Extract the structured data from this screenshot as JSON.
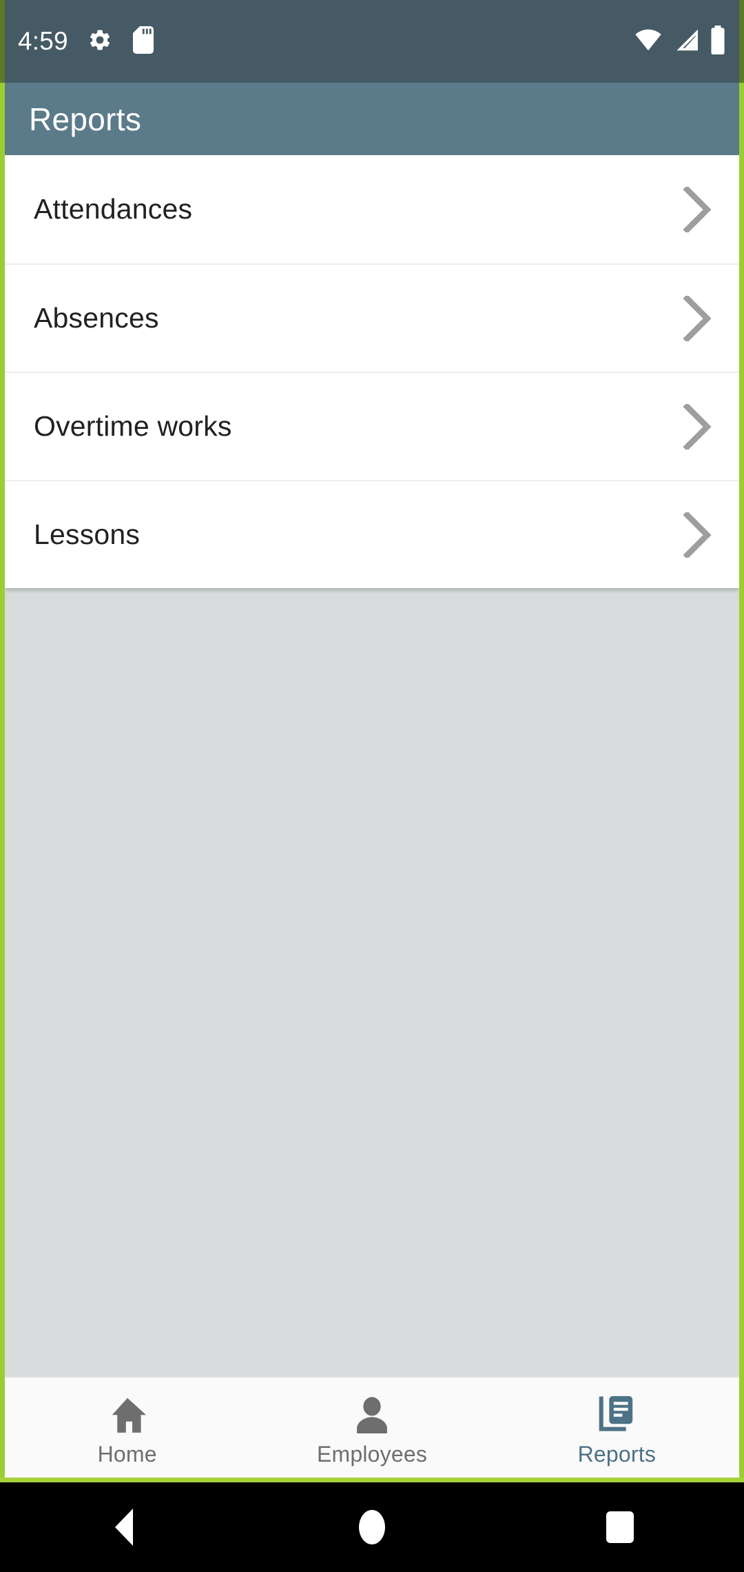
{
  "status_bar": {
    "time": "4:59",
    "left_icons": [
      "gear-icon",
      "sd-card-icon"
    ],
    "right_icons": [
      "wifi-icon",
      "cellular-signal-icon",
      "battery-icon"
    ],
    "background_color": "#455a64"
  },
  "app_bar": {
    "title": "Reports",
    "background_color": "#5b7b8a",
    "text_color": "#ffffff"
  },
  "report_list": {
    "items": [
      {
        "label": "Attendances",
        "chevron": "chevron-right-icon"
      },
      {
        "label": "Absences",
        "chevron": "chevron-right-icon"
      },
      {
        "label": "Overtime works",
        "chevron": "chevron-right-icon"
      },
      {
        "label": "Lessons",
        "chevron": "chevron-right-icon"
      }
    ]
  },
  "bottom_nav": {
    "items": [
      {
        "label": "Home",
        "icon": "home-icon",
        "active": false
      },
      {
        "label": "Employees",
        "icon": "person-icon",
        "active": false
      },
      {
        "label": "Reports",
        "icon": "library-books-icon",
        "active": true
      }
    ],
    "active_color": "#4d7285",
    "inactive_color": "#6e6e6e"
  },
  "system_nav": {
    "buttons": [
      "back-button",
      "home-button",
      "recents-button"
    ],
    "background_color": "#000000"
  },
  "accent": {
    "recording_frame_color": "#9acd32",
    "page_background": "#d8dcdc"
  }
}
